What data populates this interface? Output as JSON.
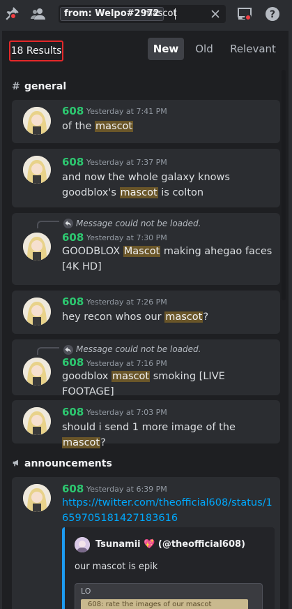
{
  "topbar": {
    "search_filter": "from: Welpo#2972",
    "search_query": "mascot",
    "icons": [
      "pinned-icon",
      "members-icon",
      "clear-icon",
      "inbox-icon",
      "help-icon"
    ]
  },
  "results": {
    "count_label": "18 Results",
    "sort_tabs": [
      {
        "label": "New",
        "active": true
      },
      {
        "label": "Old",
        "active": false
      },
      {
        "label": "Relevant",
        "active": false
      }
    ]
  },
  "groups": [
    {
      "channel": "general",
      "channel_icon": "text-channel-icon",
      "messages": [
        {
          "author": "608",
          "timestamp": "Yesterday at 7:41 PM",
          "reply": null,
          "parts": [
            "of the ",
            "mascot",
            ""
          ]
        },
        {
          "author": "608",
          "timestamp": "Yesterday at 7:37 PM",
          "reply": null,
          "parts": [
            "and now the whole galaxy knows goodblox's ",
            "mascot",
            " is colton"
          ]
        },
        {
          "author": "608",
          "timestamp": "Yesterday at 7:30 PM",
          "reply": "Message could not be loaded.",
          "parts": [
            "GOODBLOX ",
            "Mascot",
            " making ahegao faces [4K HD]"
          ]
        },
        {
          "author": "608",
          "timestamp": "Yesterday at 7:26 PM",
          "reply": null,
          "parts": [
            "hey recon whos our ",
            "mascot",
            "?"
          ]
        },
        {
          "author": "608",
          "timestamp": "Yesterday at 7:16 PM",
          "reply": "Message could not be loaded.",
          "parts": [
            "goodblox ",
            "mascot",
            " smoking [LIVE FOOTAGE]"
          ]
        },
        {
          "author": "608",
          "timestamp": "Yesterday at 7:03 PM",
          "reply": null,
          "parts": [
            "should i send 1 more image of the ",
            "mascot",
            "?"
          ]
        }
      ]
    },
    {
      "channel": "announcements",
      "channel_icon": "announcement-channel-icon",
      "messages": [
        {
          "author": "608",
          "timestamp": "Yesterday at 6:39 PM",
          "link": "https://twitter.com/theofficial608/status/1659705181427183616",
          "embed": {
            "author": "Tsunamii",
            "author_emoji": "💖",
            "handle": "(@theofficial608)",
            "text": "our mascot is epik",
            "image_label": "LO",
            "image_caption": "608:  rate the images of our mascot"
          }
        }
      ]
    }
  ],
  "colors": {
    "background": "#2b2d31",
    "panel": "#1e1f22",
    "author_green": "#2dc770",
    "highlight": "#6a5629",
    "link_blue": "#00a8fc",
    "count_outline": "#e5282a",
    "twitter_border": "#1d9bf0"
  }
}
